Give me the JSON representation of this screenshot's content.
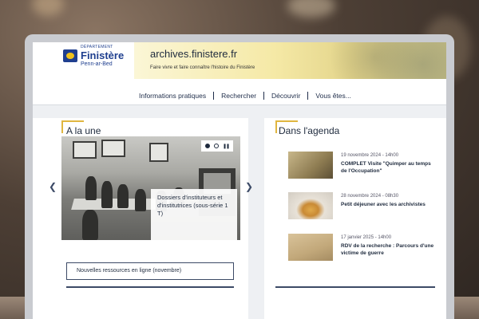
{
  "header": {
    "logo": {
      "department_label": "DÉPARTEMENT",
      "name": "Finistère",
      "sub": "Penn-ar-Bed"
    },
    "site_title": "archives.finistere.fr",
    "tagline": "Faire vivre et faire connaître l'histoire du Finistère"
  },
  "nav": {
    "items": [
      {
        "label": "Informations pratiques"
      },
      {
        "label": "Rechercher"
      },
      {
        "label": "Découvrir"
      },
      {
        "label": "Vous êtes..."
      }
    ]
  },
  "a_la_une": {
    "title": "A la une",
    "slide_caption": "Dossiers d'instituteurs et d'institutrices (sous-série 1 T)",
    "prev_icon": "chevron-left-icon",
    "next_icon": "chevron-right-icon",
    "pause_icon": "pause-icon",
    "resources_button": "Nouvelles ressources en ligne (novembre)"
  },
  "agenda": {
    "title": "Dans l'agenda",
    "items": [
      {
        "date": "19 novembre 2024 - 14h00",
        "title": "COMPLET Visite \"Quimper au temps de l'Occupation\""
      },
      {
        "date": "28 novembre 2024 - 08h30",
        "title": "Petit déjeuner avec les archivistes"
      },
      {
        "date": "17 janvier 2025 - 14h00",
        "title": "RDV de la recherche : Parcours d'une victime de guerre"
      }
    ]
  },
  "colors": {
    "navy": "#1e2a3d",
    "accent": "#e0b640",
    "brand_blue": "#1f3f8f"
  }
}
